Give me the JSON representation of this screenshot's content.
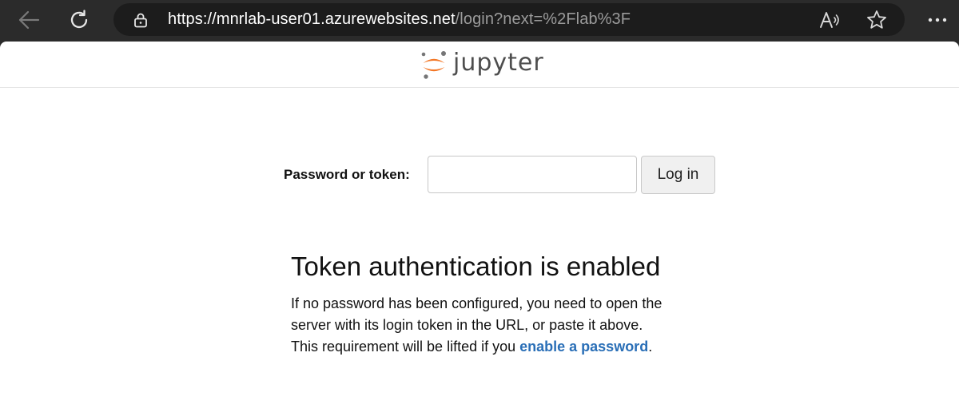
{
  "browser": {
    "url_base": "https://mnrlab-user01.azurewebsites.net",
    "url_rest": "/login?next=%2Flab%3F"
  },
  "header": {
    "wordmark": "jupyter",
    "logo_colors": {
      "orange": "#f37726",
      "gray": "#767677"
    }
  },
  "login": {
    "label": "Password or token:",
    "input_value": "",
    "input_placeholder": "",
    "button_label": "Log in"
  },
  "info": {
    "title": "Token authentication is enabled",
    "body_text": "If no password has been configured, you need to open the server with its login token in the URL, or paste it above. This requirement will be lifted if you ",
    "link_text": "enable a password",
    "body_end": "."
  },
  "icons": [
    "back-arrow-icon",
    "reload-icon",
    "lock-icon",
    "read-aloud-icon",
    "favorite-star-icon",
    "more-menu-icon",
    "jupyter-logo-icon"
  ],
  "colors": {
    "link": "#2a6fb7",
    "chrome": "#2b2b2b",
    "addressbar": "#1c1c1c"
  }
}
